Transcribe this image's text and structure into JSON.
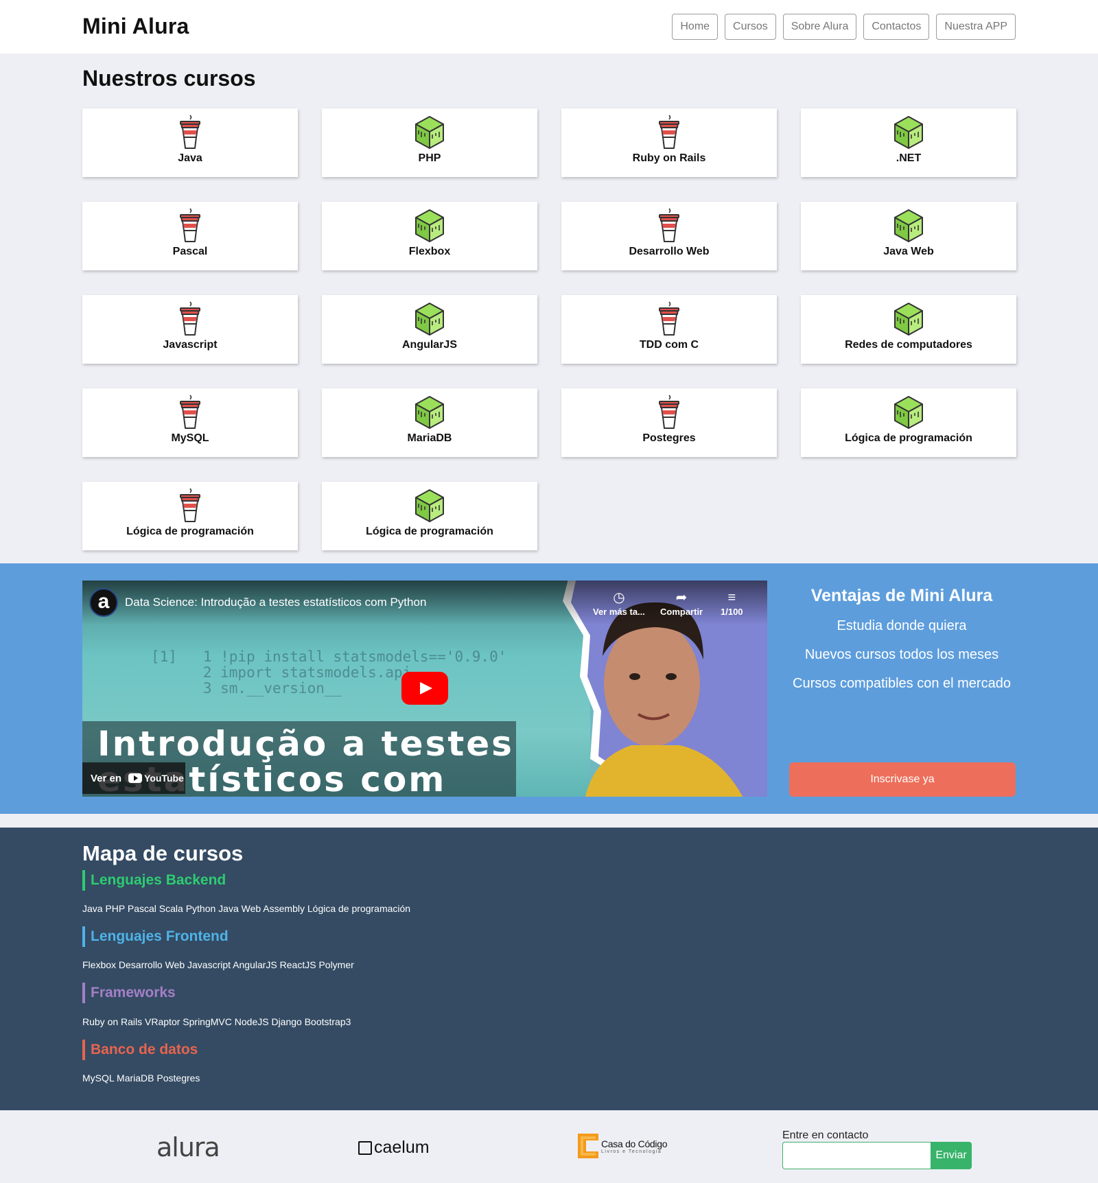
{
  "header": {
    "logo": "Mini Alura",
    "nav": [
      "Home",
      "Cursos",
      "Sobre Alura",
      "Contactos",
      "Nuestra APP"
    ]
  },
  "courses": {
    "title": "Nuestros cursos",
    "items": [
      {
        "label": "Java",
        "icon": "cup-icon"
      },
      {
        "label": "PHP",
        "icon": "cube-icon"
      },
      {
        "label": "Ruby on Rails",
        "icon": "cup-icon"
      },
      {
        "label": ".NET",
        "icon": "cube-icon"
      },
      {
        "label": "Pascal",
        "icon": "cup-icon"
      },
      {
        "label": "Flexbox",
        "icon": "cube-icon"
      },
      {
        "label": "Desarrollo Web",
        "icon": "cup-icon"
      },
      {
        "label": "Java Web",
        "icon": "cube-icon"
      },
      {
        "label": "Javascript",
        "icon": "cup-icon"
      },
      {
        "label": "AngularJS",
        "icon": "cube-icon"
      },
      {
        "label": "TDD com C",
        "icon": "cup-icon"
      },
      {
        "label": "Redes de computadores",
        "icon": "cube-icon"
      },
      {
        "label": "MySQL",
        "icon": "cup-icon"
      },
      {
        "label": "MariaDB",
        "icon": "cube-icon"
      },
      {
        "label": "Postegres",
        "icon": "cup-icon"
      },
      {
        "label": "Lógica de programación",
        "icon": "cube-icon"
      },
      {
        "label": "Lógica de programación",
        "icon": "cup-icon"
      },
      {
        "label": "Lógica de programación",
        "icon": "cube-icon"
      }
    ]
  },
  "video": {
    "channel_initial": "a",
    "title": "Data Science: Introdução a testes estatísticos com Python",
    "watch_later": "Ver más ta...",
    "share": "Compartir",
    "playlist": "1/100",
    "overlay_line1": "Introdução a testes",
    "overlay_line2": "estatísticos com",
    "code_lines": [
      "[1]   1 !pip install statsmodels=='0.9.0'",
      "      2 import statsmodels.api",
      "      3 sm.__version__"
    ],
    "watch_on": "Ver en",
    "youtube": "YouTube"
  },
  "advantages": {
    "title": "Ventajas de Mini Alura",
    "items": [
      "Estudia donde quiera",
      "Nuevos cursos todos los meses",
      "Cursos compatibles con el mercado"
    ],
    "cta": "Inscrivase ya"
  },
  "map": {
    "title": "Mapa de cursos",
    "categories": [
      {
        "name": "Lenguajes Backend",
        "color": "#2ecc71",
        "items": "Java PHP Pascal Scala Python Java Web Assembly Lógica de programación"
      },
      {
        "name": "Lenguajes Frontend",
        "color": "#4fb3e8",
        "items": "Flexbox Desarrollo Web Javascript AngularJS ReactJS Polymer"
      },
      {
        "name": "Frameworks",
        "color": "#a57fc7",
        "items": "Ruby on Rails VRaptor SpringMVC NodeJS Django Bootstrap3"
      },
      {
        "name": "Banco de datos",
        "color": "#e8644f",
        "items": "MySQL MariaDB Postegres"
      }
    ]
  },
  "footer": {
    "logos": {
      "alura": "alura",
      "caelum": "caelum",
      "casa": "Casa do Código",
      "casa_sub": "Livros e Tecnologia"
    },
    "contact_label": "Entre en contacto",
    "contact_value": "",
    "send": "Enviar"
  },
  "colors": {
    "banner": "#5d9ddc",
    "map_bg": "#344b63",
    "cta": "#ed6f5b",
    "send": "#37b36a"
  }
}
